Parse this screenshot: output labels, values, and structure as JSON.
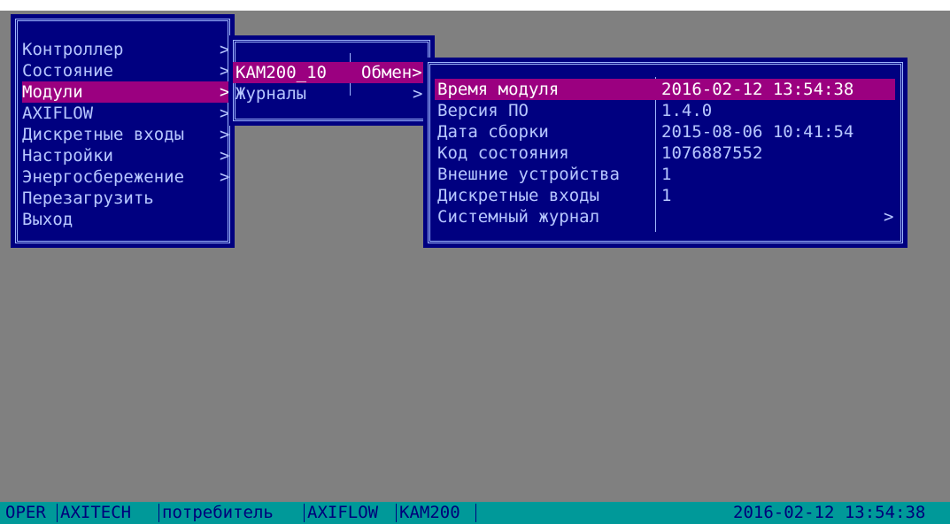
{
  "main_menu": {
    "items": [
      {
        "label": "Контроллер",
        "submenu": true
      },
      {
        "label": "Состояние",
        "submenu": true
      },
      {
        "label": "Модули",
        "submenu": true,
        "selected": true
      },
      {
        "label": "AXIFLOW",
        "submenu": true
      },
      {
        "label": "Дискретные входы",
        "submenu": true
      },
      {
        "label": "Настройки",
        "submenu": true
      },
      {
        "label": "Энергосбережение",
        "submenu": true
      },
      {
        "label": "Перезагрузить",
        "submenu": false
      },
      {
        "label": "Выход",
        "submenu": false
      }
    ]
  },
  "module_menu": {
    "items": [
      {
        "label": "KAM200_10",
        "right": "Обмен>",
        "selected": true
      },
      {
        "label": "Журналы",
        "right": "",
        "submenu": true
      }
    ]
  },
  "info_panel": {
    "rows": [
      {
        "label": "Время модуля",
        "value": "2016-02-12 13:54:38",
        "selected": true
      },
      {
        "label": "Версия ПО",
        "value": "1.4.0"
      },
      {
        "label": "Дата сборки",
        "value": "2015-08-06 10:41:54"
      },
      {
        "label": "Код состояния",
        "value": "1076887552"
      },
      {
        "label": "Внешние устройства",
        "value": "1"
      },
      {
        "label": "Дискретные входы",
        "value": "1"
      },
      {
        "label": "Системный журнал",
        "value": "",
        "submenu": true
      }
    ]
  },
  "status_bar": {
    "segments": [
      "OPER",
      "AXITECH",
      "потребитель",
      "AXIFLOW",
      "KAM200"
    ],
    "datetime": "2016-02-12 13:54:38"
  },
  "submenu_arrow": ">",
  "colors": {
    "screen": "#808080",
    "panel": "#000080",
    "text": "#b7c7ff",
    "highlight": "#9b0080",
    "status_bar": "#009999"
  }
}
